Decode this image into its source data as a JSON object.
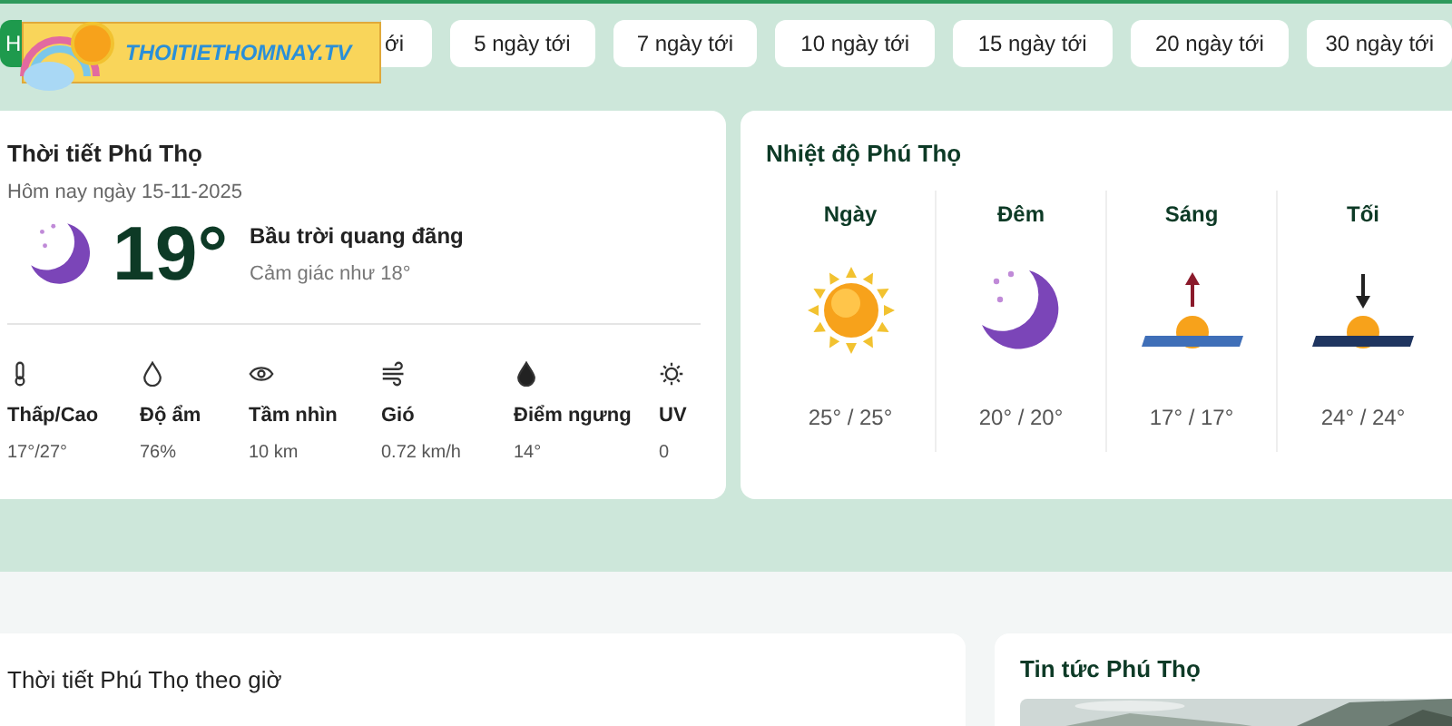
{
  "logo": {
    "text": "THOITIETHOMNAY.TV"
  },
  "tabs": [
    {
      "label": "H",
      "selected": true
    },
    {
      "label": "ới",
      "selected": false
    },
    {
      "label": "5 ngày tới",
      "selected": false
    },
    {
      "label": "7 ngày tới",
      "selected": false
    },
    {
      "label": "10 ngày tới",
      "selected": false
    },
    {
      "label": "15 ngày tới",
      "selected": false
    },
    {
      "label": "20 ngày tới",
      "selected": false
    },
    {
      "label": "30 ngày tới",
      "selected": false
    }
  ],
  "current": {
    "title": "Thời tiết Phú Thọ",
    "date": "Hôm nay ngày 15-11-2025",
    "temp": "19°",
    "condition": "Bầu trời quang đãng",
    "feels_like": "Cảm giác như 18°",
    "stats": [
      {
        "kind": "thermometer",
        "label": "Thấp/Cao",
        "value": "17°/27°"
      },
      {
        "kind": "drop",
        "label": "Độ ẩm",
        "value": "76%"
      },
      {
        "kind": "eye",
        "label": "Tầm nhìn",
        "value": "10 km"
      },
      {
        "kind": "wind",
        "label": "Gió",
        "value": "0.72 km/h"
      },
      {
        "kind": "dew",
        "label": "Điểm ngưng",
        "value": "14°"
      },
      {
        "kind": "uv",
        "label": "UV",
        "value": "0"
      }
    ]
  },
  "temps": {
    "title": "Nhiệt độ Phú Thọ",
    "periods": [
      {
        "kind": "sun",
        "label": "Ngày",
        "value": "25° / 25°"
      },
      {
        "kind": "moon",
        "label": "Đêm",
        "value": "20° / 20°"
      },
      {
        "kind": "sunrise",
        "label": "Sáng",
        "value": "17° / 17°"
      },
      {
        "kind": "sunset",
        "label": "Tối",
        "value": "24° / 24°"
      }
    ]
  },
  "hourly": {
    "title": "Thời tiết Phú Thọ theo giờ"
  },
  "news": {
    "title": "Tin tức Phú Thọ"
  }
}
